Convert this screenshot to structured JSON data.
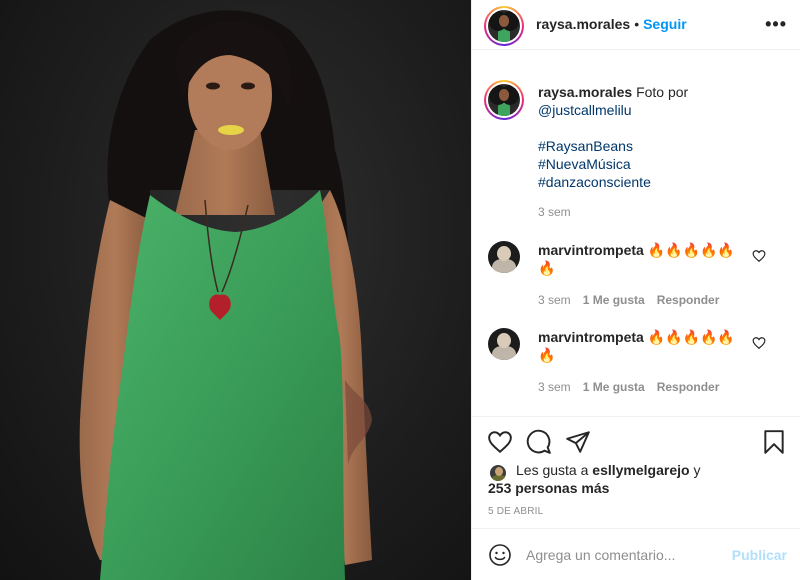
{
  "post": {
    "author": "raysa.morales",
    "follow_label": "Seguir",
    "dot": "•",
    "more_label": "•••"
  },
  "caption": {
    "author": "raysa.morales",
    "text": "Foto por",
    "mention": "@justcallmelilu",
    "hashtags": [
      "#RaysanBeans",
      "#NuevaMúsica",
      "#danzaconsciente"
    ],
    "time": "3 sem"
  },
  "comments": [
    {
      "user": "marvintrompeta",
      "text": "🔥🔥🔥🔥🔥🔥",
      "time": "3 sem",
      "likes": "1 Me gusta",
      "reply": "Responder"
    },
    {
      "user": "marvintrompeta",
      "text": "🔥🔥🔥🔥🔥🔥",
      "time": "3 sem",
      "likes": "1 Me gusta",
      "reply": "Responder"
    }
  ],
  "likes": {
    "prefix": "Les gusta a",
    "user": "esllymelgarejo",
    "joiner": "y",
    "others": "253 personas más"
  },
  "date": "5 DE ABRIL",
  "composer": {
    "placeholder": "Agrega un comentario...",
    "post_label": "Publicar"
  },
  "icons": [
    "heart-icon",
    "comment-icon",
    "share-icon",
    "bookmark-icon",
    "emoji-icon",
    "more-icon"
  ],
  "colors": {
    "link": "#0095f6",
    "hashtag": "#00376b",
    "muted": "#8e8e8e",
    "post_disabled": "#b2dffc",
    "dress": "#3fa55e"
  }
}
